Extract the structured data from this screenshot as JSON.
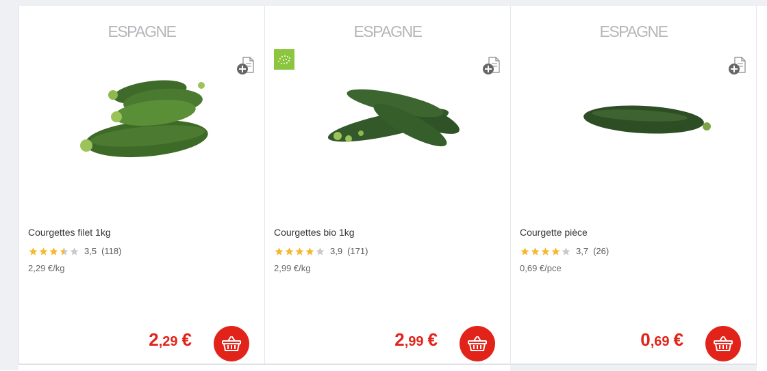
{
  "products": [
    {
      "origin": "ESPAGNE",
      "name": "Courgettes filet 1kg",
      "rating": "3,5",
      "rating_value": 3.5,
      "reviews": "(118)",
      "unit_price": "2,29 €/kg",
      "price_int": "2",
      "price_dec": ",29",
      "currency": "€",
      "bio": false,
      "icons": {
        "compare": "add-to-list-icon",
        "basket": "basket-icon"
      }
    },
    {
      "origin": "ESPAGNE",
      "name": "Courgettes bio 1kg",
      "rating": "3,9",
      "rating_value": 3.9,
      "reviews": "(171)",
      "unit_price": "2,99 €/kg",
      "price_int": "2",
      "price_dec": ",99",
      "currency": "€",
      "bio": true,
      "icons": {
        "compare": "add-to-list-icon",
        "basket": "basket-icon",
        "badge": "eu-organic-leaf-icon"
      }
    },
    {
      "origin": "ESPAGNE",
      "name": "Courgette pièce",
      "rating": "3,7",
      "rating_value": 3.7,
      "reviews": "(26)",
      "unit_price": "0,69 €/pce",
      "price_int": "0",
      "price_dec": ",69",
      "currency": "€",
      "bio": false,
      "icons": {
        "compare": "add-to-list-icon",
        "basket": "basket-icon"
      }
    }
  ],
  "colors": {
    "price": "#e2231a",
    "star_filled": "#f5b82e",
    "star_empty": "#c9c9c9",
    "bio_badge": "#8cc63f",
    "zucchini": "#3f6b2a"
  }
}
